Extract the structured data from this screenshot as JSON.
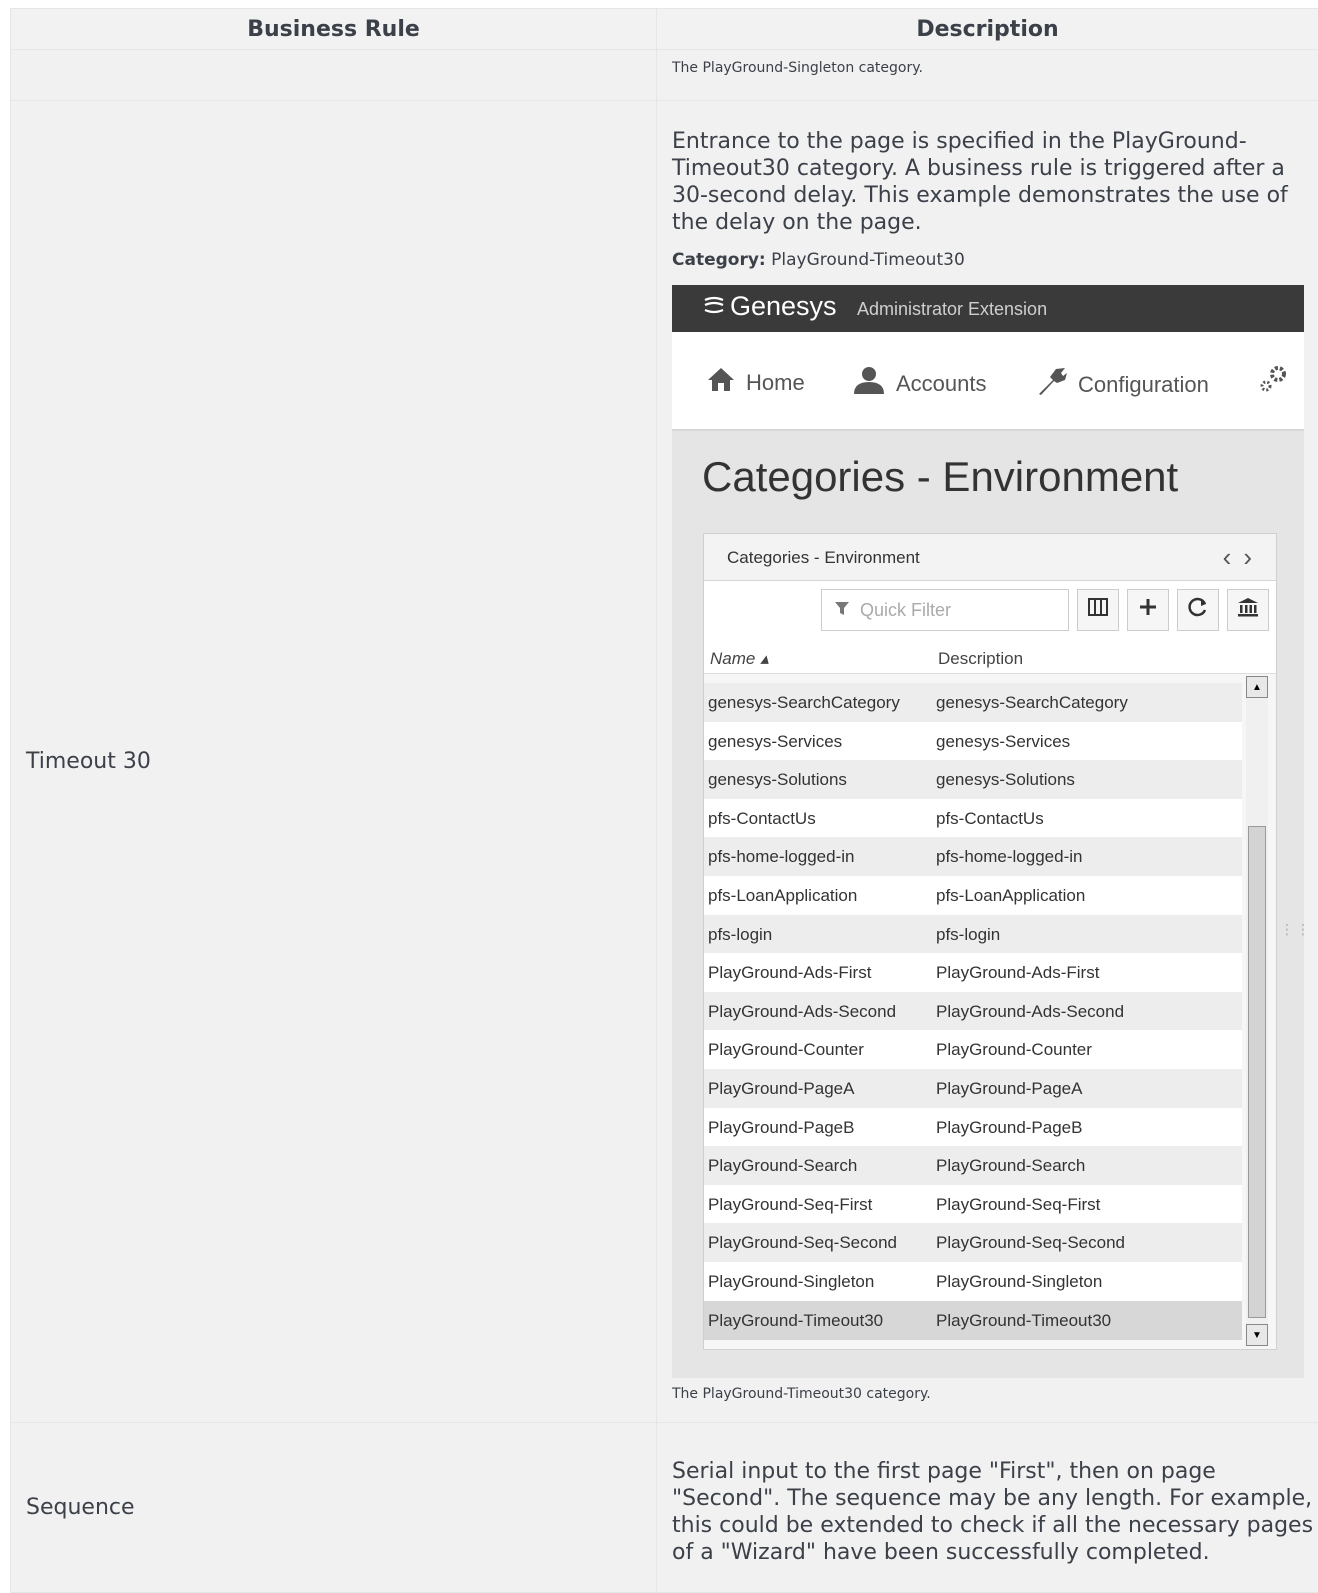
{
  "table": {
    "headers": {
      "rule": "Business Rule",
      "description": "Description"
    },
    "rows": [
      {
        "caption": "The PlayGround-Singleton category."
      },
      {
        "name": "Timeout 30",
        "text": "Entrance to the page is specified in the PlayGround-Timeout30 category. A business rule is triggered after a 30-second delay. This example demonstrates the use of the delay on the page.",
        "category_label": "Category:",
        "category_value": "PlayGround-Timeout30",
        "caption": "The PlayGround-Timeout30 category."
      },
      {
        "name": "Sequence",
        "text": "Serial input to the first page \"First\", then on page \"Second\". The sequence may be any length. For example, this could be extended to check if all the necessary pages of a \"Wizard\" have been successfully completed."
      }
    ]
  },
  "screenshot": {
    "brand": "Genesys",
    "brand_sub": "Administrator Extension",
    "nav": [
      {
        "label": "Home",
        "icon": "home-icon"
      },
      {
        "label": "Accounts",
        "icon": "user-icon"
      },
      {
        "label": "Configuration",
        "icon": "wrench-icon"
      }
    ],
    "page_title": "Categories - Environment",
    "panel_title": "Categories - Environment",
    "filter_placeholder": "Quick Filter",
    "columns": {
      "name": "Name ▴",
      "description": "Description"
    },
    "rows": [
      {
        "name": "genesys-SearchCategory",
        "description": "genesys-SearchCategory"
      },
      {
        "name": "genesys-Services",
        "description": "genesys-Services"
      },
      {
        "name": "genesys-Solutions",
        "description": "genesys-Solutions"
      },
      {
        "name": "pfs-ContactUs",
        "description": "pfs-ContactUs"
      },
      {
        "name": "pfs-home-logged-in",
        "description": "pfs-home-logged-in"
      },
      {
        "name": "pfs-LoanApplication",
        "description": "pfs-LoanApplication"
      },
      {
        "name": "pfs-login",
        "description": "pfs-login"
      },
      {
        "name": "PlayGround-Ads-First",
        "description": "PlayGround-Ads-First"
      },
      {
        "name": "PlayGround-Ads-Second",
        "description": "PlayGround-Ads-Second"
      },
      {
        "name": "PlayGround-Counter",
        "description": "PlayGround-Counter"
      },
      {
        "name": "PlayGround-PageA",
        "description": "PlayGround-PageA"
      },
      {
        "name": "PlayGround-PageB",
        "description": "PlayGround-PageB"
      },
      {
        "name": "PlayGround-Search",
        "description": "PlayGround-Search"
      },
      {
        "name": "PlayGround-Seq-First",
        "description": "PlayGround-Seq-First"
      },
      {
        "name": "PlayGround-Seq-Second",
        "description": "PlayGround-Seq-Second"
      },
      {
        "name": "PlayGround-Singleton",
        "description": "PlayGround-Singleton"
      },
      {
        "name": "PlayGround-Timeout30",
        "description": "PlayGround-Timeout30"
      }
    ]
  }
}
